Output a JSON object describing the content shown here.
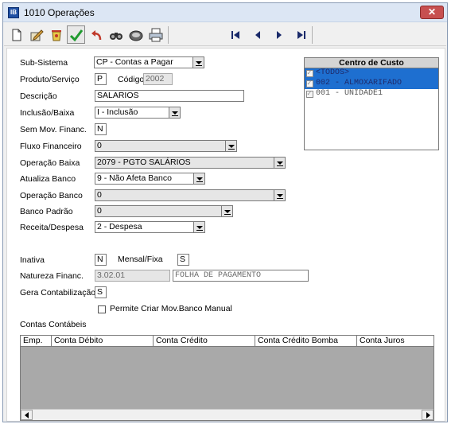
{
  "window": {
    "title": "1010 Operações",
    "icon_label": "IB",
    "close_label": "✕"
  },
  "toolbar": {
    "buttons": [
      "new-icon",
      "edit-icon",
      "delete-icon",
      "confirm-icon",
      "undo-icon",
      "search-icon",
      "print-preview-icon",
      "print-icon"
    ],
    "nav": [
      "first-icon",
      "previous-icon",
      "next-icon",
      "last-icon"
    ]
  },
  "form": {
    "subsistema": {
      "label": "Sub-Sistema",
      "value": "CP - Contas a Pagar"
    },
    "produto_servico": {
      "label": "Produto/Serviço",
      "value": "P"
    },
    "codigo": {
      "label": "Código",
      "value": "2002"
    },
    "descricao": {
      "label": "Descrição",
      "value": "SALARIOS"
    },
    "inclusao_baixa": {
      "label": "Inclusão/Baixa",
      "value": "I - Inclusão"
    },
    "sem_mov_financ": {
      "label": "Sem Mov. Financ.",
      "value": "N"
    },
    "fluxo_financeiro": {
      "label": "Fluxo Financeiro",
      "value": "0"
    },
    "operacao_baixa": {
      "label": "Operação Baixa",
      "value": "2079 - PGTO SALÁRIOS"
    },
    "atualiza_banco": {
      "label": "Atualiza Banco",
      "value": "9 - Não Afeta Banco"
    },
    "operacao_banco": {
      "label": "Operação Banco",
      "value": "0"
    },
    "banco_padrao": {
      "label": "Banco Padrão",
      "value": "0"
    },
    "receita_despesa": {
      "label": "Receita/Despesa",
      "value": "2 - Despesa"
    },
    "inativa": {
      "label": "Inativa",
      "value": "N"
    },
    "mensal_fixa": {
      "label": "Mensal/Fixa",
      "value": "S"
    },
    "natureza_financ": {
      "label": "Natureza Financ.",
      "code": "3.02.01",
      "description": "FOLHA DE PAGAMENTO"
    },
    "gera_contabilizacao": {
      "label": "Gera Contabilização",
      "value": "S"
    },
    "permite_criar": {
      "label": "Permite Criar Mov.Banco Manual",
      "checked": false
    }
  },
  "centro_custo": {
    "title": "Centro de Custo",
    "items": [
      {
        "label": "<TODOS>",
        "checked": true,
        "selected": true
      },
      {
        "label": "002 - ALMOXARIFADO",
        "checked": true,
        "selected": true
      },
      {
        "label": "001 - UNIDADE1",
        "checked": true,
        "selected": false
      }
    ]
  },
  "contas_contabeis": {
    "title": "Contas Contábeis",
    "columns": [
      "Emp.",
      "Conta Débito",
      "Conta Crédito",
      "Conta Crédito Bomba",
      "Conta Juros"
    ],
    "rows": []
  },
  "colors": {
    "selection": "#1e6fd0",
    "titlebar": "#dce6f4",
    "close": "#c75050"
  }
}
